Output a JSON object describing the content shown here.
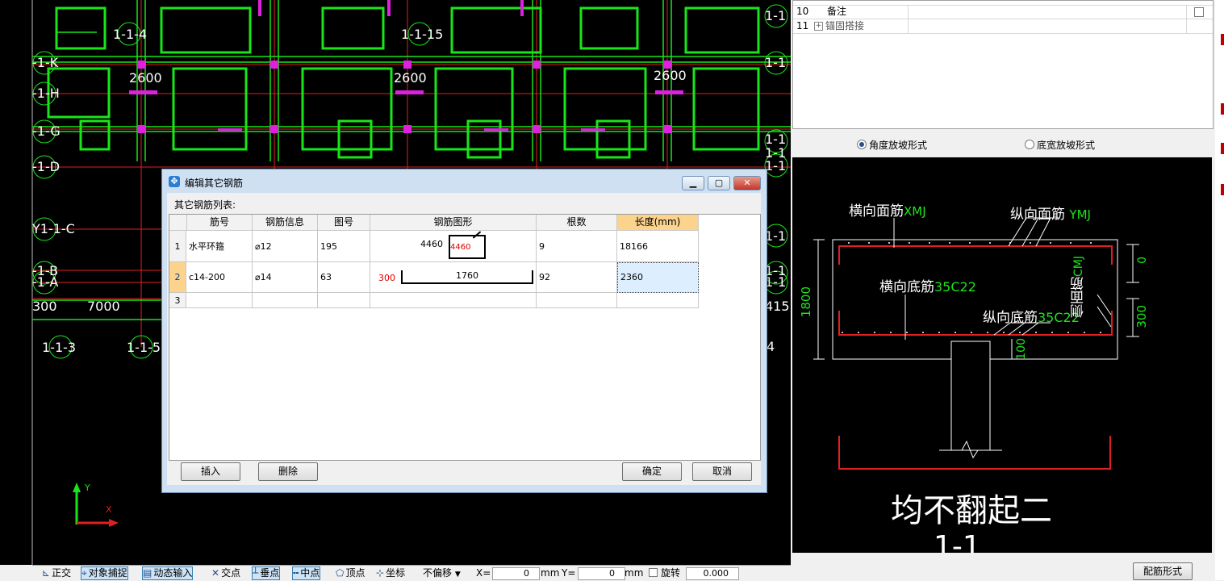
{
  "cad": {
    "labels": {
      "l114": "1-1-4",
      "l1115": "1-1-15",
      "d2600a": "2600",
      "d2600b": "2600",
      "d2600c": "2600",
      "axK": "-1-K",
      "axH": "-1-H",
      "axG": "-1-G",
      "axD": "-1-D",
      "axC": "Y1-1-C",
      "axB": "-1-B",
      "axA": "-1-A",
      "d300": "300",
      "d7000": "7000",
      "b113": "1-1-3",
      "b115": "1-1-5",
      "r1": "1-1",
      "r2": "1-1",
      "r3": "1-1",
      "r4": "1-1",
      "r5": "1-1",
      "r6": "1-1",
      "r7": "1-1",
      "r8": "1-1",
      "r415": "415",
      "r4b": "4"
    },
    "axis_y": "Y",
    "axis_x": "X"
  },
  "statusbar": {
    "orth": "正交",
    "snap": "对象捕捉",
    "dyn": "动态输入",
    "inter": "交点",
    "perp": "垂点",
    "mid": "中点",
    "vertex": "顶点",
    "coord": "坐标",
    "offset": "不偏移",
    "x_label": "X=",
    "x_value": "0",
    "x_unit": "mm",
    "y_label": "Y=",
    "y_value": "0",
    "y_unit": "mm",
    "rotate": "旋转",
    "rotate_value": "0.000"
  },
  "props": {
    "rows": [
      {
        "no": "10",
        "name": "备注"
      },
      {
        "no": "11",
        "name": "锚固搭接"
      }
    ]
  },
  "radios": {
    "angle": "角度放坡形式",
    "bottom": "底宽放坡形式"
  },
  "preview": {
    "h_top": "横向面筋",
    "h_top_code": "XMJ",
    "v_top": "纵向面筋",
    "v_top_code": "YMJ",
    "h_bot": "横向底筋",
    "h_bot_code": "35C22",
    "v_bot": "纵向底筋",
    "v_bot_code": "35C22",
    "side": "侧面筋",
    "side_code": "CMJ",
    "dim1800": "1800",
    "dim0": "0",
    "dim300": "300",
    "dim100": "100",
    "big_text": "均不翻起二",
    "section": "1-1"
  },
  "right_button": "配筋形式",
  "dialog": {
    "title": "编辑其它钢筋",
    "list_label": "其它钢筋列表:",
    "headers": [
      "筋号",
      "钢筋信息",
      "图号",
      "钢筋图形",
      "根数",
      "长度(mm)"
    ],
    "rows": [
      {
        "no": "1",
        "name": "水平环箍",
        "info": "⌀12",
        "fig": "195",
        "shape_left": "4460",
        "shape_red": "4460",
        "count": "9",
        "length": "18166"
      },
      {
        "no": "2",
        "name": "c14-200",
        "info": "⌀14",
        "fig": "63",
        "shape_left": "300",
        "shape_mid": "1760",
        "count": "92",
        "length": "2360"
      },
      {
        "no": "3",
        "name": "",
        "info": "",
        "fig": "",
        "count": "",
        "length": ""
      }
    ],
    "buttons": {
      "insert": "插入",
      "delete": "删除",
      "ok": "确定",
      "cancel": "取消"
    }
  }
}
